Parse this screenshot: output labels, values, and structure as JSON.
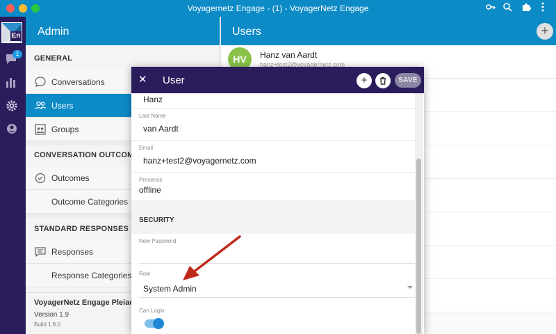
{
  "window": {
    "title": "Voyagernetz Engage - (1) - VoyagerNetz Engage"
  },
  "colors": {
    "brand_blue": "#0c8bc6",
    "rail_purple": "#2b1d5c",
    "avatar_green": "#8ac24a",
    "arrow_red": "#c0281c",
    "toggle_on": "#1e88d6"
  },
  "rail": {
    "logo_text": "En",
    "badge_count": "1",
    "icons": [
      "chat-icon",
      "bar-chart-icon",
      "gear-icon",
      "account-icon"
    ]
  },
  "sidebar": {
    "title": "Admin",
    "sections": [
      {
        "label": "GENERAL",
        "items": [
          "Conversations",
          "Users",
          "Groups"
        ]
      },
      {
        "label": "CONVERSATION OUTCOMES",
        "items": [
          "Outcomes",
          "Outcome Categories"
        ]
      },
      {
        "label": "STANDARD RESPONSES",
        "items": [
          "Responses",
          "Response Categories"
        ]
      }
    ],
    "footer": {
      "app_name": "VoyagerNetz Engage Pleiad",
      "version": "Version 1.9",
      "build": "Build 1.9.0"
    }
  },
  "users": {
    "title": "Users",
    "add_label": "+",
    "first_user": {
      "initials": "HV",
      "name": "Hanz van Aardt",
      "email": "hanz+test2@voyagernetz.com"
    }
  },
  "modal": {
    "close_label": "✕",
    "title": "User",
    "add_label": "+",
    "save_label": "SAVE",
    "first_name_value": "Hanz",
    "last_name_label": "Last Name",
    "last_name_value": "van Aardt",
    "email_label": "Email",
    "email_value": "hanz+test2@voyagernetz.com",
    "presence_label": "Presence",
    "presence_value": "offline",
    "security_label": "SECURITY",
    "new_password_label": "New Password",
    "new_password_value": "",
    "role_label": "Role",
    "role_value": "System Admin",
    "can_login_label": "Can Login",
    "can_login_value": true
  }
}
